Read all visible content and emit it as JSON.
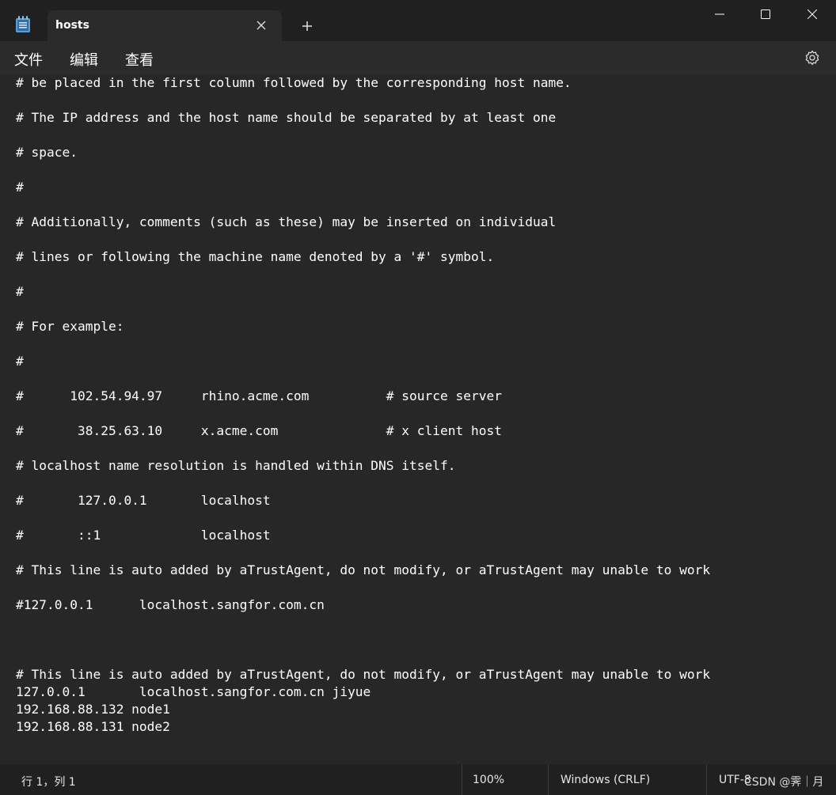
{
  "window": {
    "app_icon": "notepad-icon",
    "tab_title": "hosts",
    "tab_close_icon": "close-icon",
    "new_tab_icon": "plus-icon",
    "controls": [
      "minimize-icon",
      "maximize-icon",
      "close-icon"
    ]
  },
  "menu": {
    "items": [
      "文件",
      "编辑",
      "查看"
    ],
    "settings_icon": "gear-icon"
  },
  "editor": {
    "lines": [
      "# be placed in the first column followed by the corresponding host name.",
      "",
      "# The IP address and the host name should be separated by at least one",
      "",
      "# space.",
      "",
      "#",
      "",
      "# Additionally, comments (such as these) may be inserted on individual",
      "",
      "# lines or following the machine name denoted by a '#' symbol.",
      "",
      "#",
      "",
      "# For example:",
      "",
      "#",
      "",
      "#      102.54.94.97     rhino.acme.com          # source server",
      "",
      "#       38.25.63.10     x.acme.com              # x client host",
      "",
      "# localhost name resolution is handled within DNS itself.",
      "",
      "#       127.0.0.1       localhost",
      "",
      "#       ::1             localhost",
      "",
      "# This line is auto added by aTrustAgent, do not modify, or aTrustAgent may unable to work",
      "",
      "#127.0.0.1      localhost.sangfor.com.cn",
      "",
      "",
      "",
      "# This line is auto added by aTrustAgent, do not modify, or aTrustAgent may unable to work",
      "127.0.0.1       localhost.sangfor.com.cn jiyue",
      "192.168.88.132 node1",
      "192.168.88.131 node2"
    ]
  },
  "status": {
    "position": "行 1，列 1",
    "zoom": "100%",
    "line_ending": "Windows (CRLF)",
    "encoding": "UTF-8",
    "watermark": "CSDN @霁｜月"
  },
  "colors": {
    "background": "#272727",
    "titlebar": "#202020",
    "text": "#ffffff"
  }
}
